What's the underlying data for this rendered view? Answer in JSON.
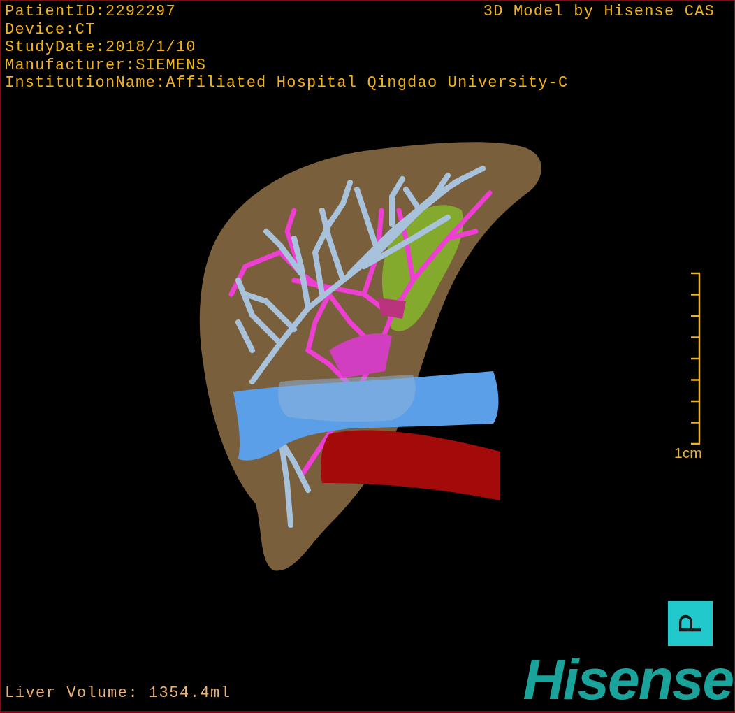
{
  "study_info": [
    "PatientID:2292297",
    "Device:CT",
    "StudyDate:2018/1/10",
    "Manufacturer:SIEMENS",
    "InstitutionName:Affiliated Hospital Qingdao University-C"
  ],
  "title": "3D Model by Hisense CAS",
  "scale_bar": {
    "label": "1cm"
  },
  "orientation_marker": "P",
  "liver_volume": "Liver Volume: 1354.4ml",
  "logo": "Hisense"
}
